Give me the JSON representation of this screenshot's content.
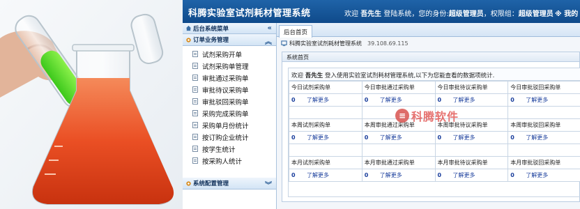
{
  "header": {
    "app_title": "科腾实验室试剂耗材管理系统",
    "welcome_prefix": "欢迎",
    "user_name": "吾先生",
    "welcome_mid": "登陆系统，您的身份:",
    "identity": "超级管理员",
    "perm_prefix": "，权限组：",
    "perm_group": "超级管理员",
    "logout_text": "※ 我的"
  },
  "sidebar": {
    "menu_title": "后台系统菜单",
    "section_title": "订单业务管理",
    "items": [
      "试剂采购开单",
      "试剂采购单管理",
      "审批通过采购单",
      "审批待议采购单",
      "审批驳回采购单",
      "采购完成采购单",
      "采购单月份统计",
      "按订购企业统计",
      "按学生统计",
      "按采购人统计"
    ],
    "config_title": "系统配置管理"
  },
  "main": {
    "tab_label": "后台首页",
    "system_name": "科腾实验室试剂耗材管理系统",
    "ip": "39.108.69.115",
    "panel_title": "系统首页",
    "intro_prefix": "欢迎",
    "intro_user": "吾先生",
    "intro_suffix": "登入使用实验室试剂耗材管理系统,以下为您能查看的数据项统计.",
    "stat_groups": [
      {
        "labels": [
          "今日试剂采购单",
          "今日审批通过采购单",
          "今日审批待议采购单",
          "今日审批驳回采购单"
        ],
        "values": [
          "0",
          "0",
          "0",
          "0"
        ]
      },
      {
        "labels": [
          "本周试剂采购单",
          "本周审批通过采购单",
          "本周审批待议采购单",
          "本周审批驳回采购单"
        ],
        "values": [
          "0",
          "0",
          "0",
          "0"
        ]
      },
      {
        "labels": [
          "本月试剂采购单",
          "本月审批通过采购单",
          "本月审批待议采购单",
          "本月审批驳回采购单"
        ],
        "values": [
          "0",
          "0",
          "0",
          "0"
        ]
      }
    ],
    "more_label": "了解更多"
  },
  "watermark": {
    "text": "科腾软件",
    "glyph": "≡"
  },
  "colors": {
    "header_blue": "#1a5a9c",
    "link_blue": "#1a3e9c",
    "watermark_red": "#e25a58"
  },
  "icons": [
    "home-icon",
    "chevron-double-left-icon",
    "gear-icon",
    "chevron-double-up-icon",
    "chevron-double-down-icon",
    "document-icon",
    "monitor-icon"
  ]
}
